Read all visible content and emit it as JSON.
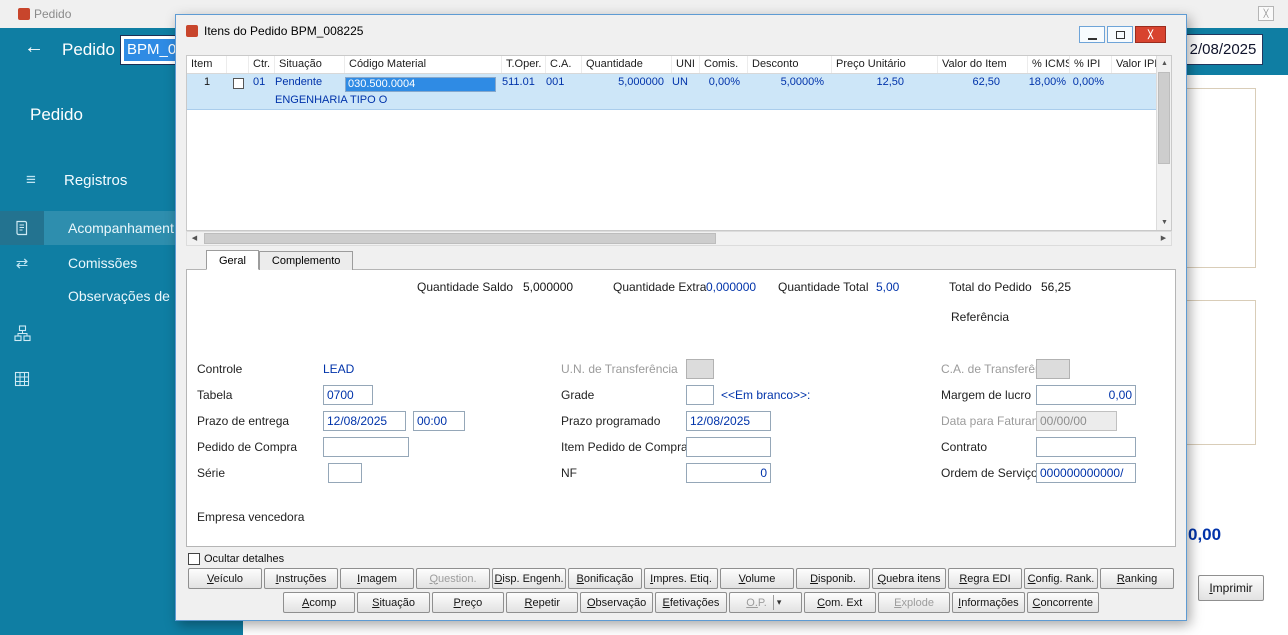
{
  "colors": {
    "teal": "#0f7ea3",
    "navy": "#0033aa",
    "selection_blue": "#2f8be4",
    "selected_row": "#cde6f8"
  },
  "icons": {
    "back": "←",
    "hamburger": "≡",
    "transfer": "⇄",
    "chevron_down": "▾",
    "dropdown": "▾",
    "scroll_up": "▲",
    "scroll_down": "▼",
    "scroll_left": "◀",
    "scroll_right": "▶",
    "close": "╳"
  },
  "background_window": {
    "titlebar": {
      "title": "Pedido"
    },
    "header": {
      "title": "Pedido",
      "order_value": "BPM_0",
      "date_value": "2/08/2025"
    },
    "sidebar": {
      "heading": "Pedido",
      "section_label": "Registros",
      "items": [
        {
          "label": "Acompanhament",
          "icon": "document-icon",
          "active": true
        },
        {
          "label": "Comissões",
          "icon": "transfer-arrows-icon",
          "active": false
        },
        {
          "label": "Observações de E",
          "icon": "",
          "active": false
        },
        {
          "label": "",
          "icon": "flowchart-icon",
          "active": false
        },
        {
          "label": "",
          "icon": "grid-icon",
          "active": false
        }
      ]
    },
    "content": {
      "amount": "0,00",
      "print_label": "Imprimir"
    }
  },
  "dialog": {
    "title": "Itens do Pedido BPM_008225",
    "grid": {
      "columns": [
        "Item",
        "",
        "Ctr.",
        "Situação",
        "Código Material",
        "T.Oper.",
        "C.A.",
        "Quantidade",
        "UNI",
        "Comis.",
        "Desconto",
        "Preço Unitário",
        "Valor do Item",
        "% ICMS",
        "% IPI",
        "Valor IPI"
      ],
      "row": {
        "item": "1",
        "ctr": "01",
        "situacao": "Pendente",
        "codigo_material": "030.500.0004",
        "descricao": "ENGENHARIA TIPO O",
        "t_oper": "511.01",
        "ca": "001",
        "quantidade": "5,000000",
        "uni": "UN",
        "comis": "0,00%",
        "desconto": "5,0000%",
        "preco_unitario": "12,50",
        "valor_item": "62,50",
        "icms": "18,00%",
        "ipi": "0,00%",
        "valor_ipi": ""
      }
    },
    "tabs": [
      {
        "label": "Geral"
      },
      {
        "label": "Complemento"
      }
    ],
    "geral": {
      "summary": [
        {
          "label": "Quantidade Saldo",
          "value": "5,000000"
        },
        {
          "label": "Quantidade Extra",
          "value": "0,000000"
        },
        {
          "label": "Quantidade Total",
          "value": "5,00"
        },
        {
          "label": "Total do Pedido",
          "value": "56,25"
        }
      ],
      "referencia_label": "Referência",
      "fields": {
        "controle": {
          "label": "Controle",
          "value": "LEAD"
        },
        "tabela": {
          "label": "Tabela",
          "value": "0700"
        },
        "prazo_entrega": {
          "label": "Prazo de entrega",
          "date": "12/08/2025",
          "time": "00:00"
        },
        "pedido_compra": {
          "label": "Pedido de Compra",
          "value": ""
        },
        "serie": {
          "label": "Série",
          "value": ""
        },
        "un_transferencia": {
          "label": "U.N. de Transferência",
          "value": ""
        },
        "grade": {
          "label": "Grade",
          "value": "",
          "hint": "<<Em branco>>:"
        },
        "prazo_programado": {
          "label": "Prazo programado",
          "value": "12/08/2025"
        },
        "item_pedido_compra": {
          "label": "Item Pedido de Compra",
          "value": ""
        },
        "nf": {
          "label": "NF",
          "value": "0"
        },
        "ca_transferencia": {
          "label": "C.A. de Transferência",
          "value": ""
        },
        "margem_lucro": {
          "label": "Margem de lucro",
          "value": "0,00"
        },
        "data_faturamento": {
          "label": "Data para Faturamento",
          "value": "00/00/00"
        },
        "contrato": {
          "label": "Contrato",
          "value": ""
        },
        "ordem_servico": {
          "label": "Ordem de Serviço",
          "value": "000000000000/"
        }
      },
      "empresa_vencedora_label": "Empresa vencedora"
    },
    "ocultar_label": "Ocultar detalhes",
    "buttons_row1": [
      {
        "label": "Veículo"
      },
      {
        "label": "Instruções"
      },
      {
        "label": "Imagem"
      },
      {
        "label": "Question.",
        "disabled": true
      },
      {
        "label": "Disp. Engenh."
      },
      {
        "label": "Bonificação"
      },
      {
        "label": "Impres. Etiq."
      },
      {
        "label": "Volume"
      },
      {
        "label": "Disponib."
      },
      {
        "label": "Quebra itens"
      },
      {
        "label": "Regra EDI"
      },
      {
        "label": "Config. Rank."
      },
      {
        "label": "Ranking"
      }
    ],
    "buttons_row2": [
      {
        "label": "Acomp"
      },
      {
        "label": "Situação"
      },
      {
        "label": "Preço"
      },
      {
        "label": "Repetir"
      },
      {
        "label": "Observação"
      },
      {
        "label": "Efetivações"
      },
      {
        "label": "O.P.",
        "disabled": true,
        "dropdown": true
      },
      {
        "label": "Com. Ext"
      },
      {
        "label": "Explode",
        "disabled": true
      },
      {
        "label": "Informações"
      },
      {
        "label": "Concorrente"
      }
    ]
  }
}
